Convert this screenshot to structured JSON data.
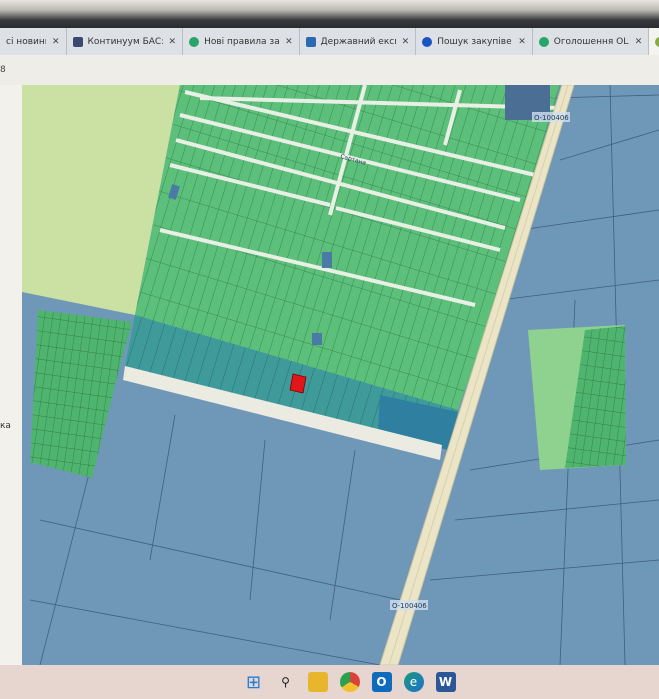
{
  "browser": {
    "tabs": [
      {
        "label": "сі новини",
        "icon": "news-icon",
        "color": "#555"
      },
      {
        "label": "Континуум БАС: рі",
        "icon": "continuum-icon",
        "color": "#3a4a6e"
      },
      {
        "label": "Нові правила закуп",
        "icon": "green-circle-icon",
        "color": "#2aa36b"
      },
      {
        "label": "Державний експерт",
        "icon": "expert-icon",
        "color": "#2a6ab0"
      },
      {
        "label": "Пошук закупівель |",
        "icon": "prozorro-icon",
        "color": "#1b54c4"
      },
      {
        "label": "Оголошення OLX.ua",
        "icon": "olx-icon",
        "color": "#23a66a"
      },
      {
        "label": "",
        "icon": "leaf-icon",
        "color": "#8aa84a"
      }
    ],
    "toolbar_text": "8"
  },
  "side_panel": {
    "text": "ка"
  },
  "map": {
    "road_labels": [
      "О-100406",
      "О-100406"
    ],
    "street_label": "Сартана",
    "colors": {
      "base": "#6f97b8",
      "parcels_green": "#5cbf7a",
      "light_field": "#cbe0a3",
      "blue_strip": "#3f8da6",
      "selected_parcel": "#e0161b",
      "road": "#ebe4c6"
    }
  },
  "taskbar": {
    "items": [
      {
        "name": "start",
        "glyph": "⊞",
        "color": "#1f7fd8"
      },
      {
        "name": "search",
        "glyph": "🔍",
        "color": "#222"
      },
      {
        "name": "file-explorer",
        "glyph": "📁",
        "color": "#e8b62c"
      },
      {
        "name": "chrome",
        "glyph": "◉",
        "color": "#d9443a"
      },
      {
        "name": "outlook",
        "glyph": "O",
        "color": "#0f6cbd"
      },
      {
        "name": "edge",
        "glyph": "e",
        "color": "#1a9a7c"
      },
      {
        "name": "word",
        "glyph": "W",
        "color": "#2b579a"
      }
    ]
  }
}
